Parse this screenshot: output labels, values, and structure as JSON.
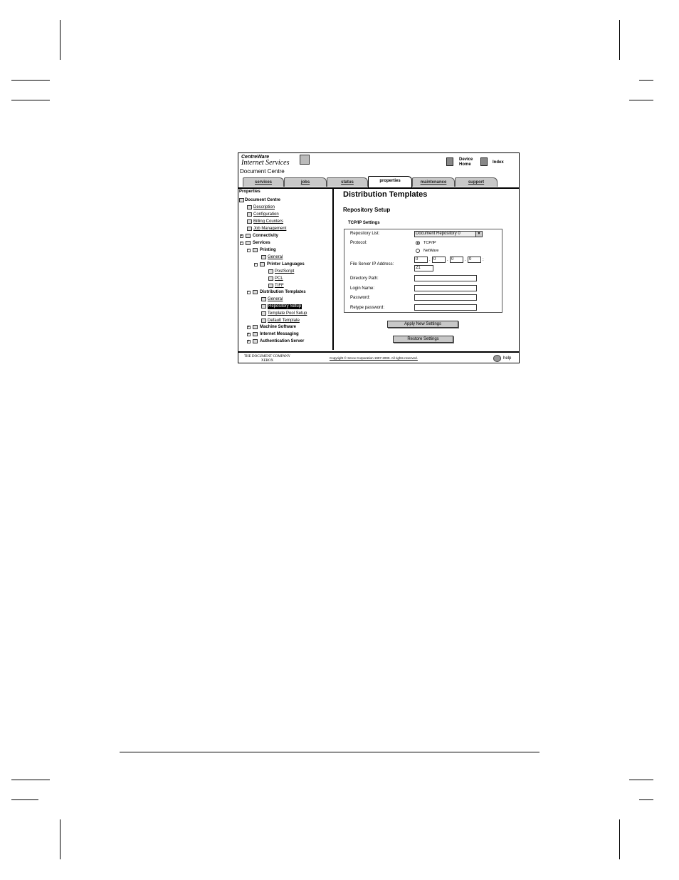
{
  "header": {
    "brand_line1": "CentreWare",
    "brand_line2": "Internet Services",
    "device_name": "Document Centre",
    "device_home_label_1": "Device",
    "device_home_label_2": "Home",
    "index_label": "Index"
  },
  "tabs": [
    {
      "label": "services",
      "active": false
    },
    {
      "label": "jobs",
      "active": false
    },
    {
      "label": "status",
      "active": false
    },
    {
      "label": "properties",
      "active": true
    },
    {
      "label": "maintenance",
      "active": false
    },
    {
      "label": "support",
      "active": false
    }
  ],
  "sidebar": {
    "title": "Properties",
    "root": "Document Centre",
    "items": [
      {
        "label": "Description"
      },
      {
        "label": "Configuration"
      },
      {
        "label": "Billing Counters"
      },
      {
        "label": "Job Management"
      },
      {
        "label": "Connectivity"
      },
      {
        "label": "Services"
      },
      {
        "label": "Printing"
      },
      {
        "label": "General"
      },
      {
        "label": "Printer Languages"
      },
      {
        "label": "PostScript"
      },
      {
        "label": "PCL"
      },
      {
        "label": "TIFF"
      },
      {
        "label": "Distribution Templates"
      },
      {
        "label": "General"
      },
      {
        "label": "Repository Setup"
      },
      {
        "label": "Template Pool Setup"
      },
      {
        "label": "Default Template"
      },
      {
        "label": "Machine Software"
      },
      {
        "label": "Internet Messaging"
      },
      {
        "label": "Authentication Server"
      }
    ]
  },
  "main": {
    "title": "Distribution Templates",
    "subtitle": "Repository Setup",
    "section": "TCP/IP Settings",
    "fields": {
      "repository_list_label": "Repository List:",
      "repository_list_value": "Document Repository 0",
      "protocol_label": "Protocol:",
      "protocol_option_1": "TCP/IP",
      "protocol_option_2": "NetWare",
      "ip_label": "File Server IP Address:",
      "ip_1": "0",
      "ip_2": "0",
      "ip_3": "0",
      "ip_4": "0",
      "port": "21",
      "directory_label": "Directory Path:",
      "login_label": "Login Name:",
      "password_label": "Password:",
      "retype_label": "Retype password:"
    },
    "apply_button": "Apply New Settings",
    "restore_button": "Restore Settings"
  },
  "footer": {
    "company_line1": "THE DOCUMENT COMPANY",
    "company_line2": "XEROX",
    "copyright": "Copyright © Xerox Corporation 1997-2000.  All rights reserved.",
    "help": "help"
  }
}
